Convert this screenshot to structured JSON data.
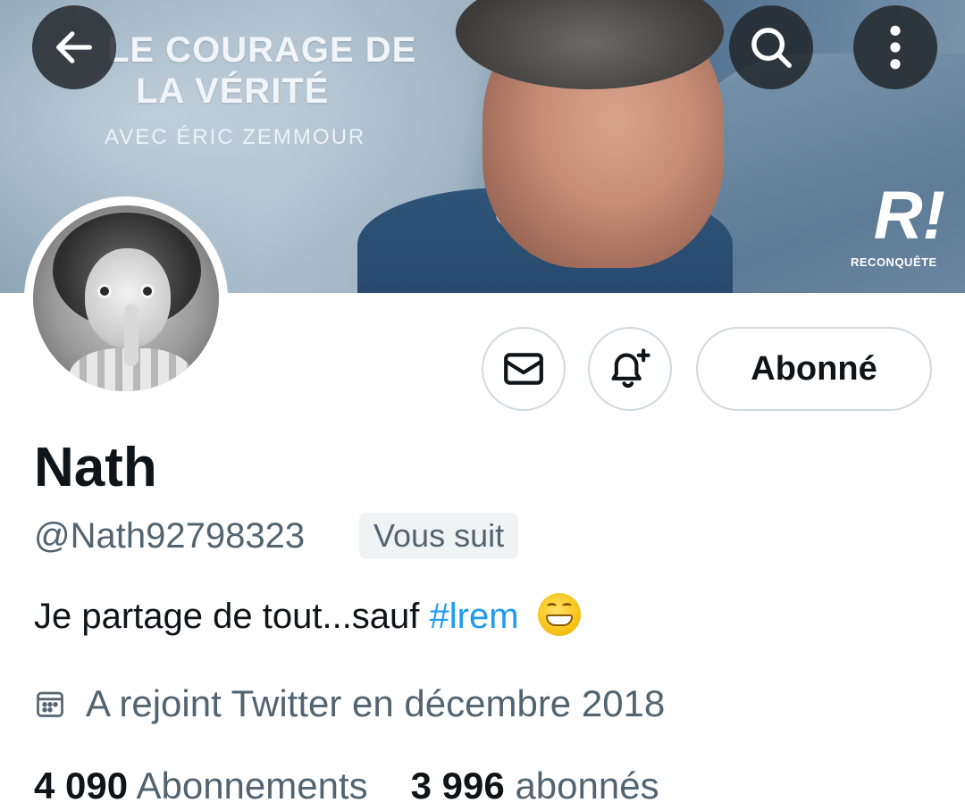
{
  "banner": {
    "title_line1": "LE COURAGE DE",
    "title_line2": "LA VÉRITÉ",
    "subtitle": "AVEC ÉRIC ZEMMOUR",
    "logo_mark": "R!",
    "logo_text": "RECONQUÊTE"
  },
  "nav": {
    "back_icon": "arrow-left-icon",
    "search_icon": "search-icon",
    "more_icon": "more-vertical-icon"
  },
  "actions": {
    "message_icon": "envelope-icon",
    "notify_icon": "bell-plus-icon",
    "follow_label": "Abonné"
  },
  "profile": {
    "name": "Nath",
    "handle": "@Nath92798323",
    "follows_you": "Vous suit",
    "bio_text": "Je partage de tout...sauf ",
    "bio_hashtag": "#lrem",
    "joined": "A rejoint Twitter en décembre 2018"
  },
  "stats": {
    "following_count": "4 090",
    "following_label": "Abonnements",
    "followers_count": "3 996",
    "followers_label": "abonnés"
  },
  "colors": {
    "link": "#1d9bf0",
    "secondary_text": "#536471",
    "primary_text": "#0f1419",
    "border": "#cfd9de"
  }
}
